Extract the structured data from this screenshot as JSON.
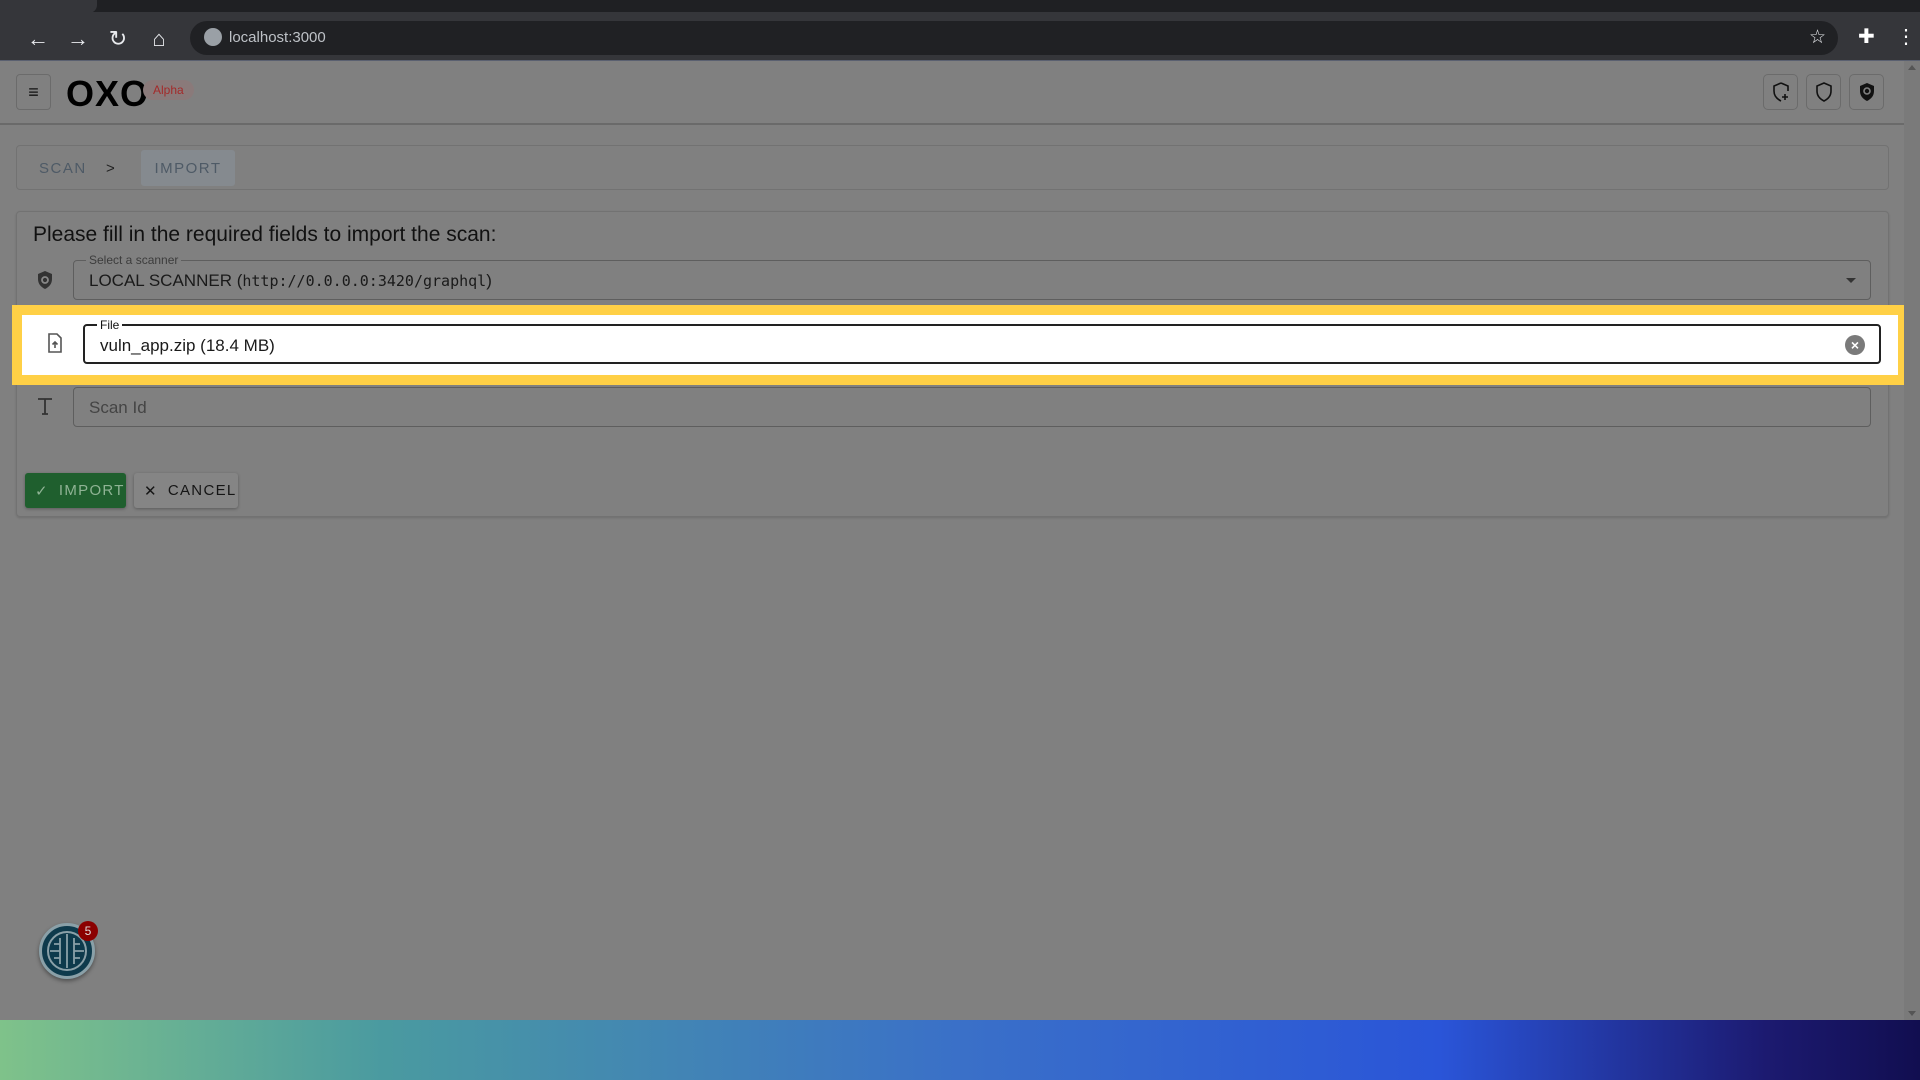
{
  "browser": {
    "url": "localhost:3000"
  },
  "app": {
    "logo": "OXO",
    "badge": "Alpha",
    "header_icons": [
      "shield-plus-icon",
      "shield-icon",
      "shield-search-icon"
    ]
  },
  "breadcrumb": {
    "items": [
      "SCAN",
      ">",
      "IMPORT"
    ]
  },
  "form": {
    "title": "Please fill in the required fields to import the scan:",
    "scanner": {
      "label": "Select a scanner",
      "value_name": "LOCAL SCANNER (",
      "value_url": "http://0.0.0.0:3420/graphql",
      "value_end": ")"
    },
    "file": {
      "label": "File",
      "value": "vuln_app.zip (18.4 MB)"
    },
    "scan_id": {
      "placeholder": "Scan Id"
    },
    "import_label": "IMPORT",
    "cancel_label": "CANCEL"
  },
  "notification": {
    "count": "5"
  },
  "colors": {
    "highlight": "#ffd046",
    "import_button": "#1f5f2e",
    "alpha_text": "#a32a2a"
  }
}
